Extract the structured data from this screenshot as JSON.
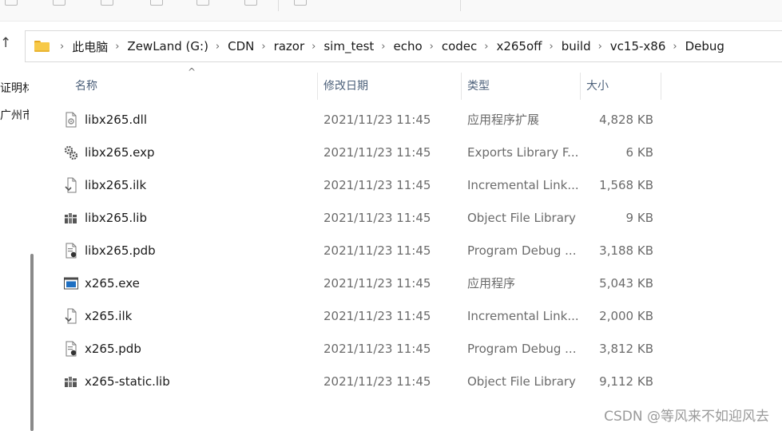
{
  "addressbar": {
    "crumbs": [
      "此电脑",
      "ZewLand (G:)",
      "CDN",
      "razor",
      "sim_test",
      "echo",
      "codec",
      "x265off",
      "build",
      "vc15-x86",
      "Debug"
    ],
    "separator": "›"
  },
  "navigation": {
    "up_glyph": "↑",
    "items": [
      "证明材",
      "广州市"
    ]
  },
  "columns": {
    "name": "名称",
    "date": "修改日期",
    "type": "类型",
    "size": "大小",
    "sort_glyph": "^"
  },
  "files": [
    {
      "name": "libx265.dll",
      "date": "2021/11/23 11:45",
      "type": "应用程序扩展",
      "size": "4,828 KB",
      "icon": "dll-file-icon"
    },
    {
      "name": "libx265.exp",
      "date": "2021/11/23 11:45",
      "type": "Exports Library F...",
      "size": "6 KB",
      "icon": "exp-file-icon"
    },
    {
      "name": "libx265.ilk",
      "date": "2021/11/23 11:45",
      "type": "Incremental Link...",
      "size": "1,568 KB",
      "icon": "ilk-file-icon"
    },
    {
      "name": "libx265.lib",
      "date": "2021/11/23 11:45",
      "type": "Object File Library",
      "size": "9 KB",
      "icon": "lib-file-icon"
    },
    {
      "name": "libx265.pdb",
      "date": "2021/11/23 11:45",
      "type": "Program Debug ...",
      "size": "3,188 KB",
      "icon": "pdb-file-icon"
    },
    {
      "name": "x265.exe",
      "date": "2021/11/23 11:45",
      "type": "应用程序",
      "size": "5,043 KB",
      "icon": "exe-file-icon"
    },
    {
      "name": "x265.ilk",
      "date": "2021/11/23 11:45",
      "type": "Incremental Link...",
      "size": "2,000 KB",
      "icon": "ilk-file-icon"
    },
    {
      "name": "x265.pdb",
      "date": "2021/11/23 11:45",
      "type": "Program Debug ...",
      "size": "3,812 KB",
      "icon": "pdb-file-icon"
    },
    {
      "name": "x265-static.lib",
      "date": "2021/11/23 11:45",
      "type": "Object File Library",
      "size": "9,112 KB",
      "icon": "lib-file-icon"
    }
  ],
  "watermark": "CSDN @等风来不如迎风去",
  "colors": {
    "folder": "#f7c948",
    "header_text": "#4c607a",
    "exe_blue": "#1e6fc2"
  }
}
